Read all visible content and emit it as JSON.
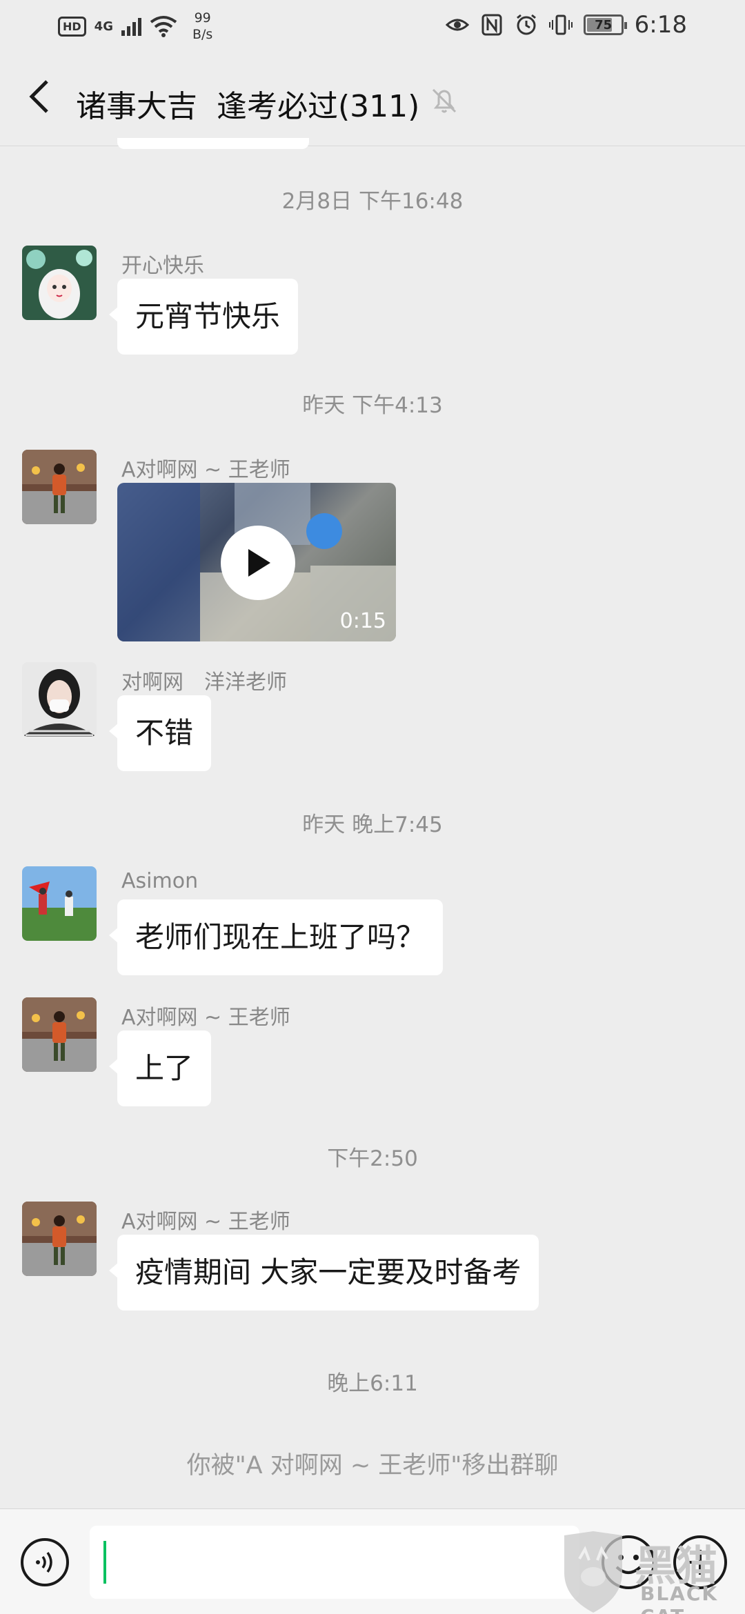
{
  "status_bar": {
    "network_badge": "HD",
    "network_type": "4G",
    "speed_value": "99",
    "speed_unit": "B/s",
    "battery": "75",
    "time": "6:18"
  },
  "header": {
    "back_icon": "chevron-left-icon",
    "title": "诸事大吉  逢考必过(311)",
    "mute_icon": "bell-off-icon"
  },
  "messages": [
    {
      "kind": "time",
      "text": "2月8日 下午16:48"
    },
    {
      "kind": "text",
      "sender": "开心快乐",
      "text": "元宵节快乐"
    },
    {
      "kind": "time",
      "text": "昨天 下午4:13"
    },
    {
      "kind": "video",
      "sender": "A对啊网 ~ 王老师",
      "duration": "0:15"
    },
    {
      "kind": "text",
      "sender": "对啊网　洋洋老师",
      "text": "不错"
    },
    {
      "kind": "time",
      "text": "昨天 晚上7:45"
    },
    {
      "kind": "text",
      "sender": "Asimon",
      "text": "老师们现在上班了吗？"
    },
    {
      "kind": "text",
      "sender": "A对啊网 ~ 王老师",
      "text": "上了"
    },
    {
      "kind": "time",
      "text": "下午2:50"
    },
    {
      "kind": "text",
      "sender": "A对啊网 ~ 王老师",
      "text": "疫情期间 大家一定要及时备考"
    },
    {
      "kind": "time",
      "text": "晚上6:11"
    },
    {
      "kind": "system",
      "text": "你被\"A 对啊网 ~ 王老师\"移出群聊"
    }
  ],
  "input_bar": {
    "voice_icon": "voice-icon",
    "emoji_icon": "emoji-icon",
    "plus_icon": "plus-icon",
    "input_value": ""
  },
  "watermark": {
    "chinese": "黑猫",
    "english": "BLACK CAT"
  }
}
